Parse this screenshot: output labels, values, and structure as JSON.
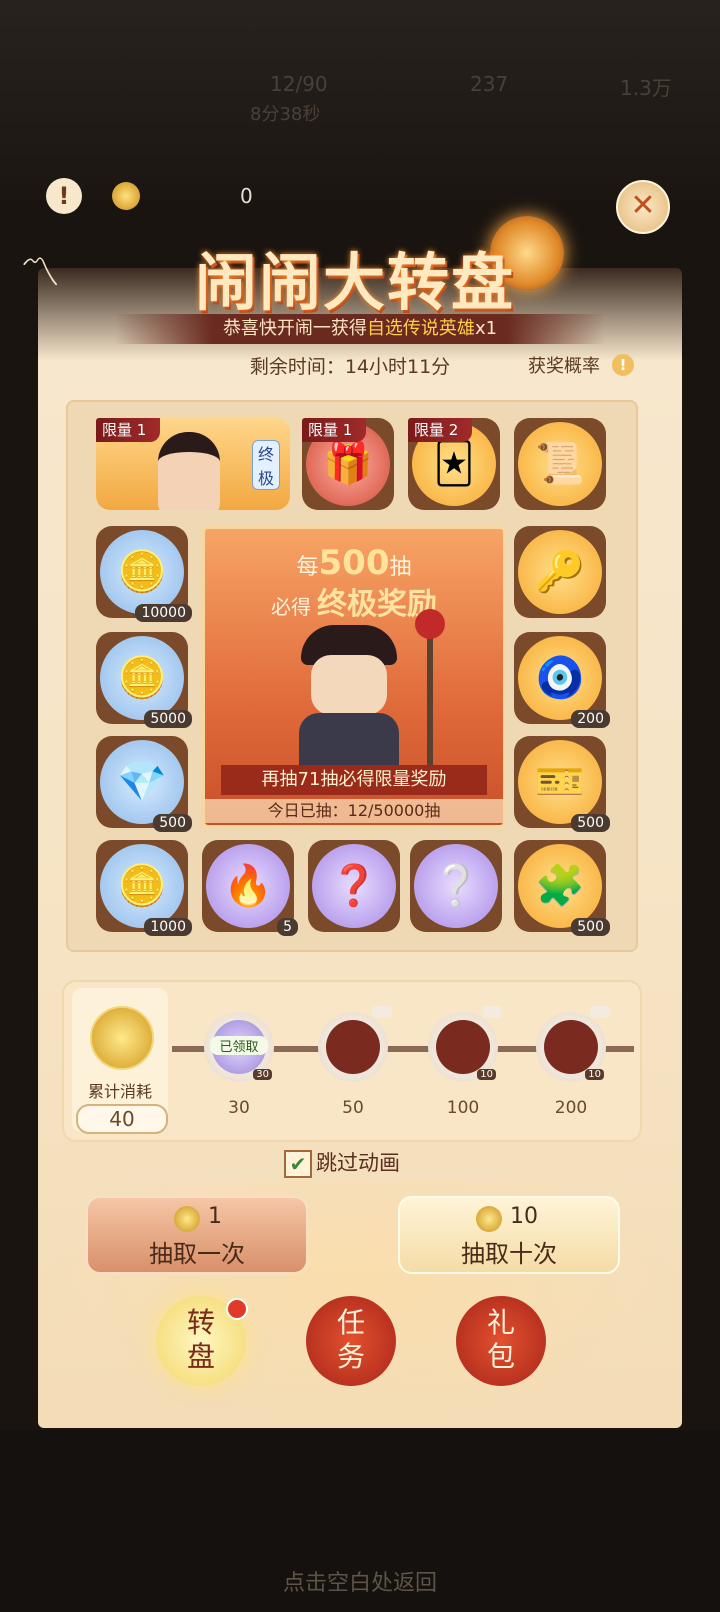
{
  "header": {
    "top_count": "0",
    "title": "闹闹大转盘",
    "subtitle_prefix": "恭喜快开闹一获得",
    "subtitle_highlight": "自选传说英雄",
    "subtitle_suffix": "x1",
    "remaining": "剩余时间：14小时11分",
    "probability": "获奖概率"
  },
  "grid": {
    "limits": [
      "限量 1",
      "限量 1",
      "限量 2"
    ],
    "hero_tag": "终极",
    "quantities": {
      "c_r1": "10000",
      "c_r2": "5000",
      "c_r3": "500",
      "c_b1": "1000",
      "c_b2": "5",
      "c_b5": "500",
      "c_rt3": "200",
      "c_rt4": "500"
    },
    "center": {
      "line1_prefix": "每",
      "line1_num": "500",
      "line1_suffix": "抽",
      "line2_prefix": "必得",
      "line2_highlight": "终极奖励",
      "banner": "再抽71抽必得限量奖励",
      "today": "今日已抽：12/50000抽"
    }
  },
  "consume": {
    "label": "累计消耗",
    "value": "40",
    "done_tag": "已领取",
    "milestones": [
      "30",
      "50",
      "100",
      "200"
    ],
    "badges": [
      "30",
      "",
      "10",
      "10"
    ]
  },
  "skip_label": "跳过动画",
  "draw_one": {
    "cost": "1",
    "label": "抽取一次"
  },
  "draw_ten": {
    "cost": "10",
    "label": "抽取十次"
  },
  "nav": {
    "spin": "转\n盘",
    "task": "任\n务",
    "gift": "礼\n包"
  },
  "footer": {
    "return_hint": "点击空白处返回"
  },
  "bg_hud": {
    "a": "12/90",
    "b": "237",
    "c": "1.3万",
    "d": "8分38秒"
  }
}
